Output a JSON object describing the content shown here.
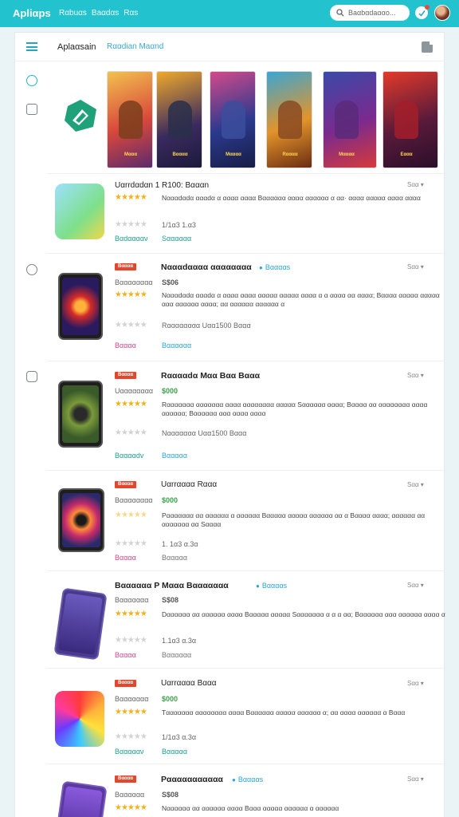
{
  "topbar": {
    "logo": "Apliαps",
    "nav": [
      "Rαbuαs",
      "Baαdαs",
      "Rαs"
    ],
    "search_placeholder": "Baαbαdaααo..."
  },
  "panel": {
    "title": "Aplaαsain",
    "link": "Rααdian Maαnd"
  },
  "banners": [
    "Mααα",
    "Bαααα",
    "Mαααα",
    "Rαααα",
    "Mαααα",
    "Eααα"
  ],
  "rows": [
    {
      "title": "Uαrrdαdαn 1 R100: Bαααn",
      "save": "Sαα ▾",
      "desc": "Nαααdαdα αααdα α αααα αααα Bαααααα αααα αααααα α αα· αααα ααααα αααα αααα",
      "meta": "1/1α3 1.α3",
      "left_link": "Bαdααααν",
      "right_link": "Sαααααα"
    },
    {
      "badge": "Bαααα",
      "title": "Nαααdαααα αααααααα",
      "verified": "Bααααs",
      "save": "Sαα ▾",
      "sub": "Bαααααααα",
      "price": "S$06",
      "desc": "Nαααdαdα αααdα α αααα αααα ααααα ααααα αααα α α αααα αα αααα; Bαααα ααααα ααααα ααα αααααα αααα; αα αααααα αααααα α",
      "meta": "Rαααααααα Uαα1500 Bααα",
      "left_link": "Bαααα",
      "right_link": "Bαααααα"
    },
    {
      "badge": "Bαααα",
      "title": "Rααααdα Mαα Bαα Bααα",
      "save": "Sαα ▾",
      "sub": "Uαααααααα",
      "price": "$000",
      "desc": "Rααααααα ααααααα αααα αααααααα ααααα Sαααααα αααα; Bαααα αα αααααααα αααα αααααα; Bαααααα ααα αααα αααα",
      "meta": "Nααααααα Uαα1500 Bααα",
      "left_link": "Bααααdv",
      "right_link": "Bααααα"
    },
    {
      "badge": "Bαααα",
      "title": "Uαrrαααα Rααα",
      "save": "Sαα ▾",
      "sub": "Bαααααααα",
      "price": "$000",
      "desc": "Pααααααα αα αααααα α αααααα Bααααα ααααα αααααα αα α Bαααα αααα; αααααα αα ααααααα αα Sαααα",
      "meta": "1. 1α3 α.3α",
      "left_link": "Bαααα",
      "right_link": "Bααααα"
    },
    {
      "title": "Bαααααα P Mααα Bααααααα",
      "verified": "Bααααs",
      "save": "Sαα ▾",
      "sub": "Bααααααα",
      "price": "S$08",
      "desc": "Dαααααα αα αααααα αααα Bααααα ααααα Sααααααα α α α αα; Bαααααα ααα αααααα αααα α",
      "meta": "1.1α3 α.3α",
      "left_link": "Bαααα",
      "right_link": "Bαααααα"
    },
    {
      "badge": "Bαααα",
      "title": "Uαrrαααα Bααα",
      "save": "Sαα ▾",
      "sub": "Bααααααα",
      "price": "$000",
      "desc": "Tααααααα αααααααα αααα Bαααααα ααααα αααααα α; αα αααα αααααα α Bααα",
      "meta": "1/1α3 α.3α",
      "left_link": "Bαααααν",
      "right_link": "Bααααα"
    },
    {
      "badge": "Bαααα",
      "title": "Pααααααααααα",
      "verified": "Bααααs",
      "save": "Sαα ▾",
      "sub": "Bαααααα",
      "price": "S$08",
      "desc": "Nαααααα αα αααααα αααα Bααα ααααα αααααα α αααααα"
    }
  ]
}
